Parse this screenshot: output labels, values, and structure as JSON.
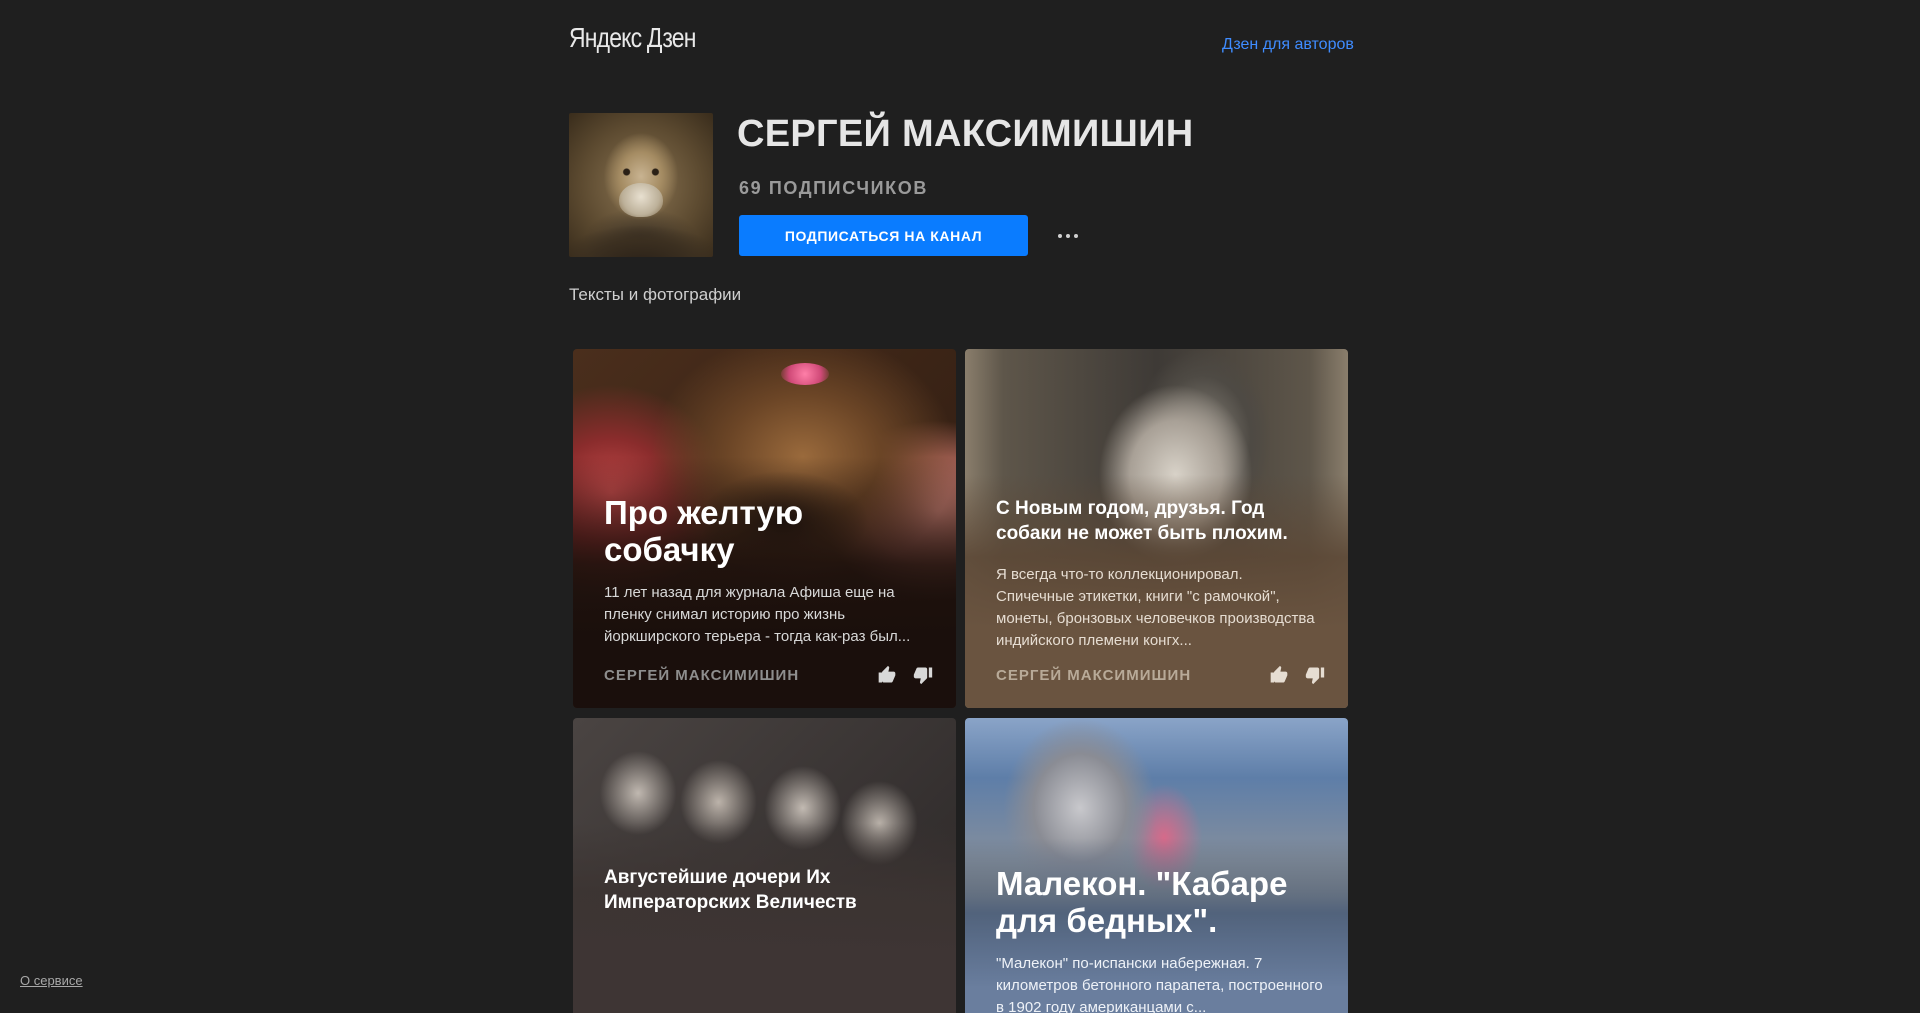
{
  "header": {
    "logo": "Яндекс Дзен",
    "authors_link": "Дзен для авторов"
  },
  "channel": {
    "name": "СЕРГЕЙ МАКСИМИШИН",
    "subscribers": "69 ПОДПИСЧИКОВ",
    "subscribe_label": "ПОДПИСАТЬСЯ НА КАНАЛ",
    "description": "Тексты и фотографии"
  },
  "cards": [
    {
      "title": "Про желтую собачку",
      "text": "11 лет назад для журнала Афиша еще на пленку снимал историю про жизнь йоркширского терьера - тогда как-раз был...",
      "author": "СЕРГЕЙ МАКСИМИШИН"
    },
    {
      "title": "С Новым годом, друзья. Год собаки не может быть плохим.",
      "text": "Я всегда что-то коллекционировал. Спичечные этикетки, книги \"с рамочкой\", монеты, бронзовых человечков производства  индийского племени конгх...",
      "author": "СЕРГЕЙ МАКСИМИШИН"
    },
    {
      "title": "Августейшие дочери Их Императорских Величеств"
    },
    {
      "title": "Малекон. \"Кабаре для бедных\".",
      "text": "\"Малекон\" по-испански набережная. 7 километров бетонного парапета, построенного в 1902 году американцами с..."
    }
  ],
  "footer": {
    "about_link": "О сервисе"
  },
  "colors": {
    "background": "#1f1f1f",
    "accent": "#0a7cff",
    "link": "#3f8cff"
  },
  "icons": {
    "like": "thumbs-up-icon",
    "dislike": "thumbs-down-icon",
    "more": "more-dots-icon"
  }
}
